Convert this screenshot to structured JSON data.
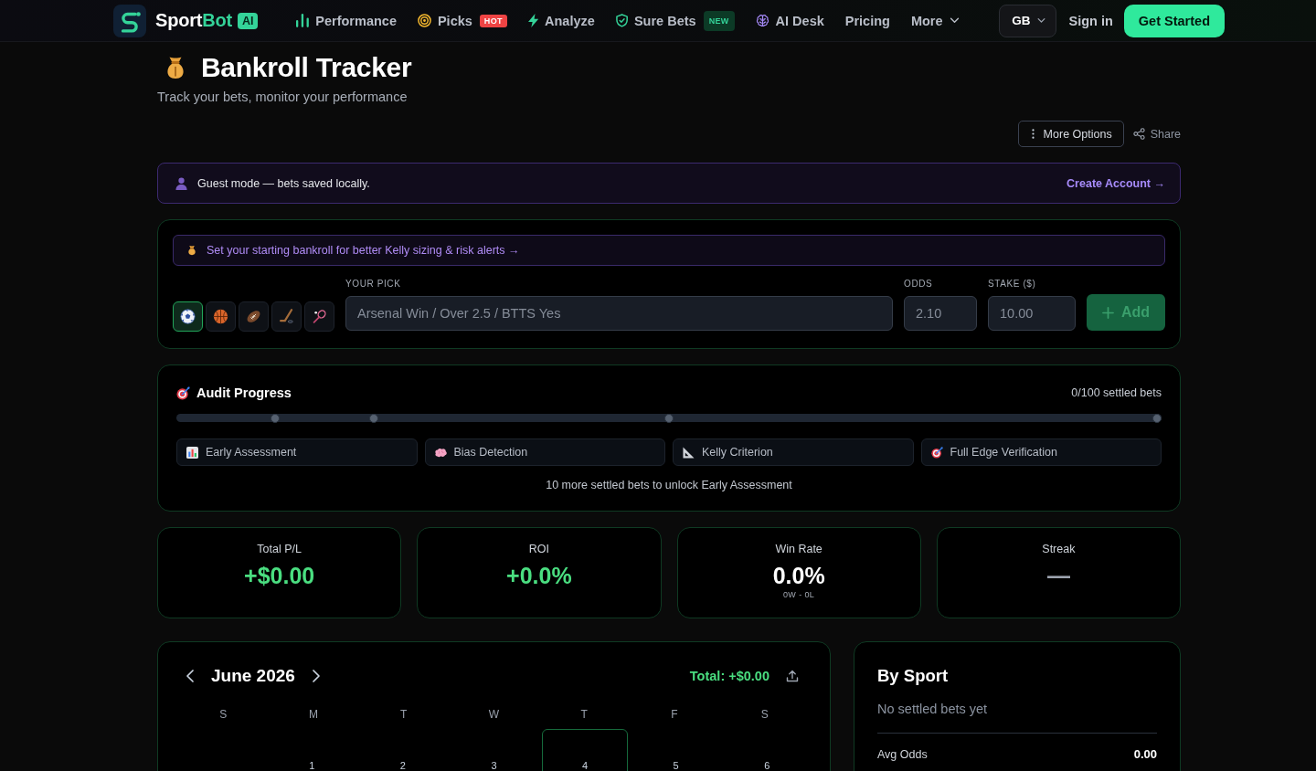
{
  "nav": {
    "logo": {
      "text_parts": [
        "Sport",
        "Bot"
      ],
      "badge": "AI"
    },
    "items": [
      {
        "label": "Performance",
        "dropdown": false
      },
      {
        "label": "Picks",
        "dropdown": false,
        "badge": {
          "text": "HOT",
          "kind": "hot"
        }
      },
      {
        "label": "Analyze",
        "dropdown": false
      },
      {
        "label": "Sure Bets",
        "dropdown": false,
        "badge": {
          "text": "NEW",
          "kind": "new"
        }
      },
      {
        "label": "AI Desk",
        "dropdown": false
      },
      {
        "label": "Pricing",
        "dropdown": false
      },
      {
        "label": "More",
        "dropdown": true
      }
    ],
    "region": "GB",
    "sign_in": "Sign in",
    "get_started": "Get Started"
  },
  "header": {
    "title": "Bankroll Tracker",
    "subtitle": "Track your bets, monitor your performance"
  },
  "toolbar": {
    "more_options": "More Options",
    "share": "Share"
  },
  "guest_banner": {
    "message": "Guest mode — bets saved locally.",
    "link": "Create Account →"
  },
  "bet_form": {
    "bankroll_alert": "Set your starting bankroll for better Kelly sizing & risk alerts →",
    "sports": [
      {
        "selected": true
      },
      {
        "selected": false
      },
      {
        "selected": false
      },
      {
        "selected": false
      },
      {
        "selected": false
      }
    ],
    "pick": {
      "label": "YOUR PICK",
      "placeholder": "Arsenal Win / Over 2.5 / BTTS Yes"
    },
    "odds": {
      "label": "ODDS",
      "placeholder": "2.10"
    },
    "stake": {
      "label": "STAKE ($)",
      "placeholder": "10.00"
    },
    "add_button": {
      "label": "Add",
      "disabled": true
    }
  },
  "audit": {
    "title": "Audit Progress",
    "count": "0/100 settled bets",
    "level": 0,
    "milestones": [
      {
        "level": 0.1,
        "reached": false
      },
      {
        "level": 0.2,
        "reached": false
      },
      {
        "level": 0.5,
        "reached": false
      },
      {
        "level": 1,
        "reached": false
      }
    ],
    "stages": [
      {
        "label": "Early Assessment",
        "unlocked": false
      },
      {
        "label": "Bias Detection",
        "unlocked": false
      },
      {
        "label": "Kelly Criterion",
        "unlocked": false
      },
      {
        "label": "Full Edge Verification",
        "unlocked": false
      }
    ],
    "note": "10 more settled bets to unlock Early Assessment"
  },
  "stats": [
    {
      "label": "Total P/L",
      "value": "+$0.00",
      "kind": "positive"
    },
    {
      "label": "ROI",
      "value": "+0.0%",
      "kind": "positive"
    },
    {
      "label": "Win Rate",
      "value": "0.0%",
      "kind": "neutral",
      "detail": "0W - 0L"
    },
    {
      "label": "Streak",
      "value": "—",
      "kind": "muted"
    }
  ],
  "calendar": {
    "month": "June 2026",
    "total": "Total: +$0.00",
    "weekdays": [
      "S",
      "M",
      "T",
      "W",
      "T",
      "F",
      "S"
    ],
    "cells": [
      {
        "kind": "blank"
      },
      {
        "kind": "day",
        "label": "1",
        "today": false
      },
      {
        "kind": "day",
        "label": "2",
        "today": false
      },
      {
        "kind": "day",
        "label": "3",
        "today": false
      },
      {
        "kind": "day",
        "label": "4",
        "today": true
      },
      {
        "kind": "day",
        "label": "5",
        "today": false
      },
      {
        "kind": "day",
        "label": "6",
        "today": false
      }
    ]
  },
  "by_sport": {
    "title": "By Sport",
    "empty": "No settled bets yet",
    "rows": [
      {
        "label": "Avg Odds",
        "value": "0.00"
      }
    ]
  }
}
